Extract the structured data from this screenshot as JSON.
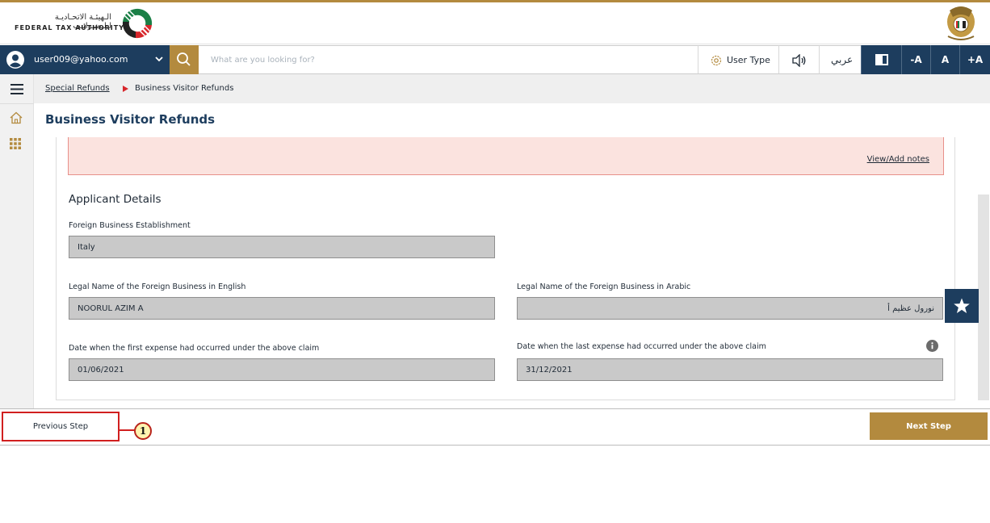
{
  "header": {
    "logo_text_ar": "الـهيئـة الاتحـاديـة لـلـضـرائـب",
    "logo_text_en": "FEDERAL TAX AUTHORITY",
    "emblem_icon": "uae-emblem-icon"
  },
  "topbar": {
    "user_email": "user009@yahoo.com",
    "search_placeholder": "What are you looking for?",
    "user_type_label": "User Type",
    "language_label": "عربي",
    "font_decrease": "-A",
    "font_normal": "A",
    "font_increase": "+A"
  },
  "breadcrumb": {
    "parent": "Special Refunds",
    "current": "Business Visitor Refunds"
  },
  "page": {
    "title": "Business Visitor Refunds",
    "view_notes_link": "View/Add notes",
    "section_title": "Applicant Details"
  },
  "fields": {
    "foreign_establishment": {
      "label": "Foreign Business Establishment",
      "value": "Italy"
    },
    "legal_name_en": {
      "label": "Legal Name of the Foreign Business in English",
      "value": "NOORUL AZIM A"
    },
    "legal_name_ar": {
      "label": "Legal Name of the Foreign Business in Arabic",
      "value": "نورول عظيم أ"
    },
    "first_expense_date": {
      "label": "Date when the first expense had occurred under the above claim",
      "value": "01/06/2021"
    },
    "last_expense_date": {
      "label": "Date when the last expense had occurred under the above claim",
      "value": "31/12/2021"
    }
  },
  "footer": {
    "previous_label": "Previous Step",
    "next_label": "Next Step",
    "callout_number": "1"
  },
  "colors": {
    "navy": "#1d3d5e",
    "gold": "#b38a3e",
    "notes_bg": "#fbe3df",
    "field_bg": "#c9c9c9",
    "callout_red": "#d11f1f"
  }
}
